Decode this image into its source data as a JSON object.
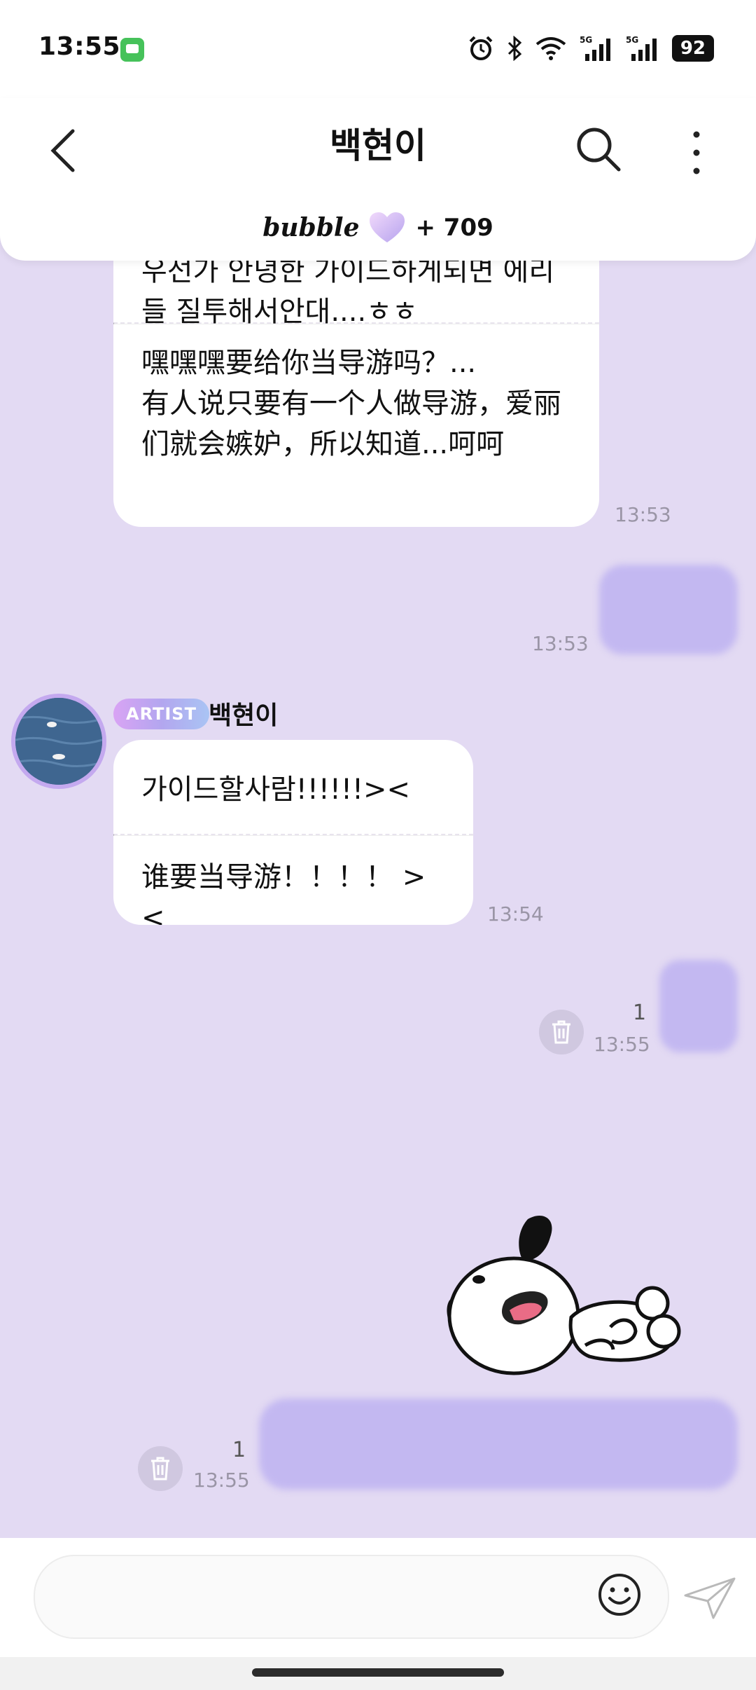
{
  "status_bar": {
    "time": "13:55",
    "battery": "92"
  },
  "header": {
    "title": "백현이",
    "bubble_logo": "bubble",
    "bubble_count": "+ 709"
  },
  "messages": [
    {
      "sections": [
        "우선가 안녕한 가이드하게되면 에리들 질투해서안대....ㅎㅎ",
        "嘿嘿嘿要给你当导游吗？...\n有人说只要有一个人做导游，爱丽们就会嫉妒，所以知道...呵呵"
      ],
      "time": "13:53"
    },
    {
      "time": "13:53"
    },
    {
      "badge": "ARTIST",
      "sender": "백현이",
      "sections": [
        "가이드할사람!!!!!!><",
        "谁要当导游！！！！ ><"
      ],
      "time": "13:54"
    },
    {
      "count": "1",
      "time": "13:55"
    },
    {
      "count": "1",
      "time": "13:55"
    }
  ],
  "colors": {
    "chat_bg": "#e3daf3",
    "my_bubble": "#c3b8f1",
    "artist_badge": "#c3a8f2"
  }
}
